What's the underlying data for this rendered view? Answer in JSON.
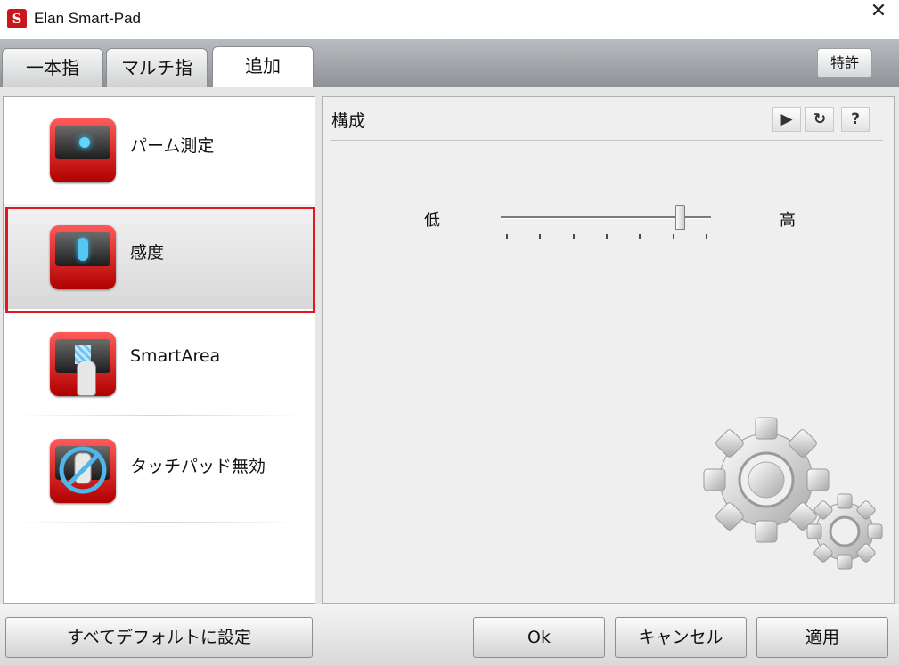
{
  "window": {
    "title": "Elan Smart-Pad",
    "icon": "elan-logo-icon",
    "close_glyph": "✕"
  },
  "tabs": [
    {
      "label": "一本指",
      "active": false
    },
    {
      "label": "マルチ指",
      "active": false
    },
    {
      "label": "追加",
      "active": true
    }
  ],
  "patent_button": "特許",
  "sidebar": {
    "items": [
      {
        "label": "パーム測定",
        "icon": "palm-check-icon",
        "selected": false
      },
      {
        "label": "感度",
        "icon": "sensitivity-icon",
        "selected": true
      },
      {
        "label": "SmartArea",
        "icon": "smartarea-icon",
        "selected": false
      },
      {
        "label": "タッチパッド無効",
        "icon": "touchpad-disable-icon",
        "selected": false
      }
    ]
  },
  "config": {
    "title": "構成",
    "tools": {
      "play": "▶",
      "refresh": "↻",
      "help": "?"
    },
    "slider": {
      "low_label": "低",
      "high_label": "高",
      "value_fraction": 0.85,
      "ticks": 7
    },
    "decoration": "gears-icon"
  },
  "footer": {
    "defaults_button": "すべてデフォルトに設定",
    "ok_button": "Ok",
    "cancel_button": "キャンセル",
    "apply_button": "適用"
  },
  "colors": {
    "accent": "#e0181f",
    "icon_red": "#c00000",
    "glow": "#2ad0ff"
  }
}
